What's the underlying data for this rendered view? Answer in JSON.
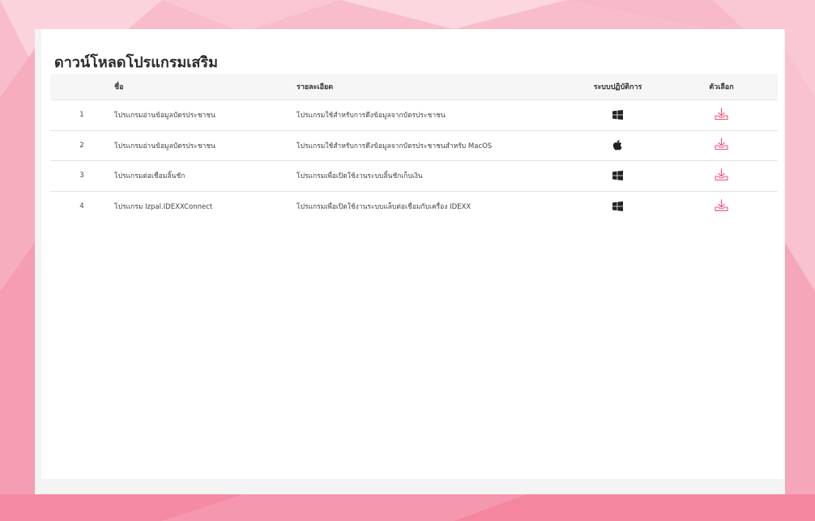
{
  "page": {
    "title": "ดาวน์โหลดโปรแกรมเสริม"
  },
  "table": {
    "headers": {
      "name": "ชื่อ",
      "description": "รายละเอียด",
      "os": "ระบบปฏิบัติการ",
      "options": "ตัวเลือก"
    },
    "rows": [
      {
        "num": "1",
        "name": "โปรแกรมอ่านข้อมูลบัตรประชาชน",
        "description": "โปรแกรมใช้สำหรับการดึงข้อมูลจากบัตรประชาชน",
        "os": "windows-icon"
      },
      {
        "num": "2",
        "name": "โปรแกรมอ่านข้อมูลบัตรประชาชน",
        "description": "โปรแกรมใช้สำหรับการดึงข้อมูลจากบัตรประชาชนสำหรับ MacOS",
        "os": "apple-icon"
      },
      {
        "num": "3",
        "name": "โปรแกรมต่อเชื่อมลิ้นชัก",
        "description": "โปรแกรมเพื่อเปิดใช้งานระบบลิ้นชักเก็บเงิน",
        "os": "windows-icon"
      },
      {
        "num": "4",
        "name": "โปรแกรม Izpal.IDEXXConnect",
        "description": "โปรแกรมเพื่อเปิดใช้งานระบบแล็บต่อเชื่อมกับเครื่อง IDEXX",
        "os": "windows-icon"
      }
    ]
  },
  "colors": {
    "accent": "#e8577a",
    "background_pink": "#f7b6c5"
  }
}
